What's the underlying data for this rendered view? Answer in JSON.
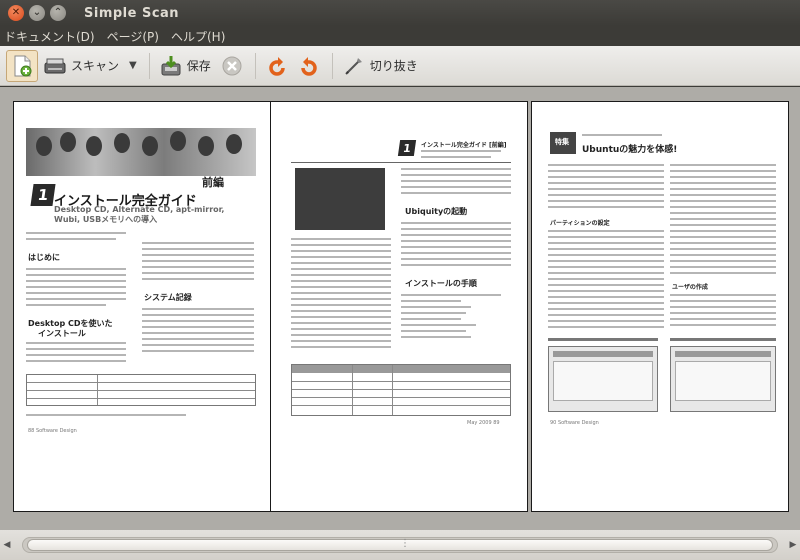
{
  "window": {
    "title": "Simple Scan"
  },
  "menubar": {
    "items": [
      "ドキュメント(D)",
      "ページ(P)",
      "ヘルプ(H)"
    ]
  },
  "toolbar": {
    "new_icon": "new-document-icon",
    "scan_label": "スキャン",
    "scan_menu_icon": "dropdown-arrow-icon",
    "save_label": "保存",
    "stop_icon": "stop-icon",
    "rotate_left_icon": "rotate-left-icon",
    "rotate_right_icon": "rotate-right-icon",
    "crop_label": "切り抜き"
  },
  "pages": [
    {
      "section_label": "前編",
      "chapter_number": "1",
      "title": "インストール完全ガイド",
      "subtitle_1": "Desktop CD, Alternate CD, apt-mirror,",
      "subtitle_2": "Wubi, USBメモリへの導入",
      "heading_1": "はじめに",
      "heading_2": "Desktop CDを使いた",
      "heading_3": "インストール",
      "heading_4": "システム記録",
      "page_footer": "88 Software Design"
    },
    {
      "chapter_number": "1",
      "title": "インストール完全ガイド [前編]",
      "heading_1": "Ubiquityの起動",
      "heading_2": "インストールの手順",
      "page_footer": "May 2009 89"
    },
    {
      "section_label": "特集",
      "title": "Ubuntuの魅力を体感!",
      "heading_1": "パーティションの設定",
      "heading_2": "ユーザの作成",
      "page_footer": "90 Software Design"
    }
  ],
  "colors": {
    "title_bar": "#3c3b37",
    "toolbar": "#e6e4e0",
    "viewport": "#aeaca7",
    "close_button": "#d8491c",
    "page": "#ffffff"
  }
}
